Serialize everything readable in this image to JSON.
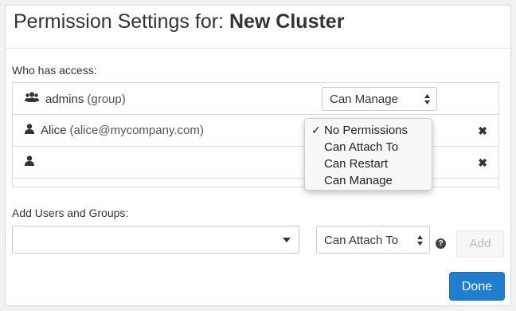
{
  "dialog": {
    "title_prefix": "Permission Settings for:",
    "title_name": "New Cluster",
    "who_has_access_label": "Who has access:",
    "add_users_label": "Add Users and Groups:"
  },
  "acl": {
    "rows": [
      {
        "name": "admins",
        "detail": "(group)",
        "icon": "group-icon",
        "permission": "Can Manage"
      },
      {
        "name": "Alice",
        "detail": "(alice@mycompany.com)",
        "icon": "user-icon",
        "remove": "✖"
      },
      {
        "name": "",
        "detail": "",
        "icon": "user-icon",
        "remove": "✖"
      }
    ]
  },
  "permission_dropdown": {
    "checkmark": "✓",
    "options": [
      "No Permissions",
      "Can Attach To",
      "Can Restart",
      "Can Manage"
    ],
    "selected_index": 0
  },
  "add_form": {
    "user_select_value": "",
    "permission_value": "Can Attach To",
    "help": "?",
    "add_button": "Add",
    "done_button": "Done"
  },
  "colors": {
    "primary": "#1f7ed0",
    "border": "#dcdcdc"
  }
}
